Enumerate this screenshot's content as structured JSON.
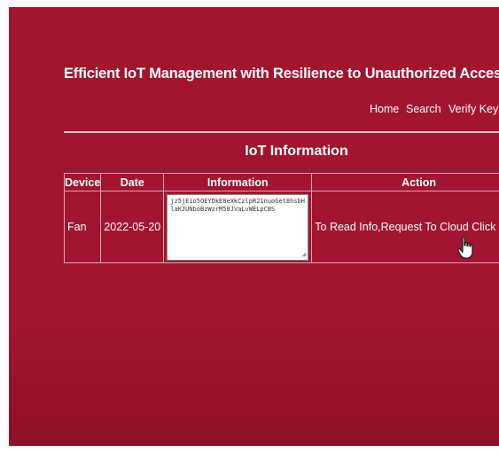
{
  "header": {
    "title": "Efficient IoT Management with Resilience to Unauthorized Access to Cloud Storage"
  },
  "nav": [
    {
      "label": "Home"
    },
    {
      "label": "Search"
    },
    {
      "label": "Verify Key"
    }
  ],
  "main": {
    "section_title": "IoT Information",
    "table": {
      "headers": [
        "Device",
        "Date",
        "Information",
        "Action"
      ],
      "rows": [
        {
          "device": "Fan",
          "date": "2022-05-20",
          "information": "jz5jEio5OEYDkE8eXkCzlpR21nuoGet8hsbHlaKJUNboBzWzrM58JVaLvWELpCBS",
          "action_text": "To Read Info,Request To Cloud",
          "action_link": "Click Here"
        }
      ]
    }
  },
  "colors": {
    "background": "#a1152f",
    "text": "#ffffff"
  }
}
